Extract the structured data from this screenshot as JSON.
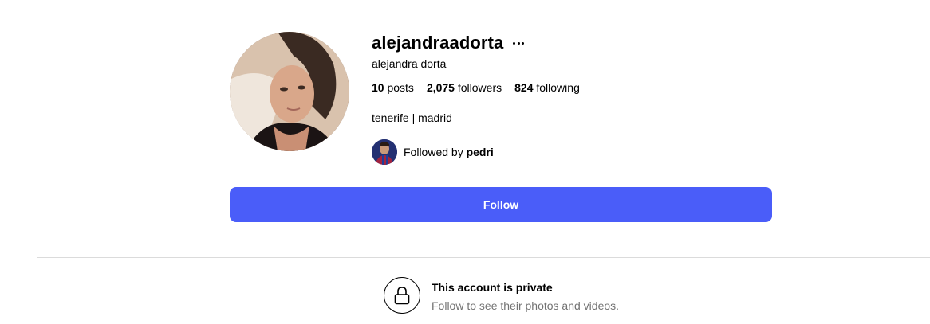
{
  "profile": {
    "username": "alejandraadorta",
    "full_name": "alejandra dorta",
    "bio": "tenerife | madrid",
    "stats": {
      "posts_count": "10",
      "posts_label": "posts",
      "followers_count": "2,075",
      "followers_label": "followers",
      "following_count": "824",
      "following_label": "following"
    },
    "followed_by": {
      "prefix": "Followed by",
      "name": "pedri"
    }
  },
  "actions": {
    "follow_label": "Follow"
  },
  "private_notice": {
    "title": "This account is private",
    "subtitle": "Follow to see their photos and videos."
  },
  "colors": {
    "follow_button": "#4a5df9",
    "divider": "#dbdbdb",
    "secondary_text": "#737373"
  }
}
